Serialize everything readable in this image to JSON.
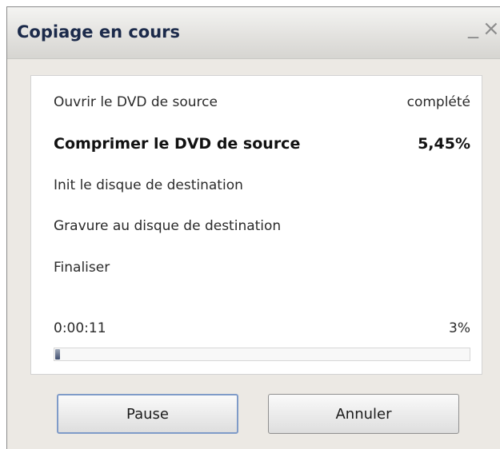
{
  "window": {
    "title": "Copiage en cours",
    "minimize_glyph": "_",
    "close_glyph": "×"
  },
  "steps": [
    {
      "label": "Ouvrir le DVD de source",
      "status": "complété",
      "active": false
    },
    {
      "label": "Comprimer le DVD de source",
      "status": "5,45%",
      "active": true
    },
    {
      "label": "Init le disque de destination",
      "status": "",
      "active": false
    },
    {
      "label": "Gravure au disque de destination",
      "status": "",
      "active": false
    },
    {
      "label": "Finaliser",
      "status": "",
      "active": false
    }
  ],
  "progress": {
    "elapsed": "0:00:11",
    "percent_label": "3%",
    "fraction": 0.012
  },
  "buttons": {
    "pause": "Pause",
    "cancel": "Annuler"
  }
}
